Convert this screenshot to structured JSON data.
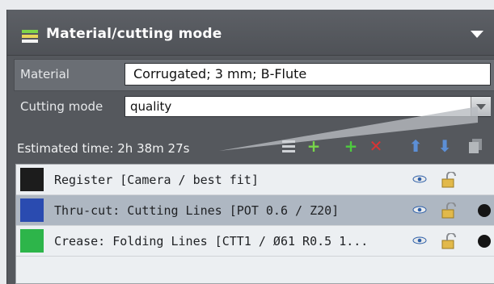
{
  "header": {
    "title": "Material/cutting mode",
    "icon": "layers-icon",
    "collapse_icon": "chevron-down-icon"
  },
  "material": {
    "label": "Material",
    "value": "Corrugated; 3 mm; B-Flute"
  },
  "cutting_mode": {
    "label": "Cutting mode",
    "value": "quality"
  },
  "estimated_time": "Estimated time: 2h 38m 27s",
  "toolbar": [
    "list-view-icon",
    "add-icon",
    "add-sub-icon",
    "delete-icon",
    "move-up-icon",
    "move-down-icon",
    "copy-icon"
  ],
  "layers": [
    {
      "label": "Register [Camera / best fit]",
      "color": "#1c1c1c",
      "selected": false,
      "has_dot": false
    },
    {
      "label": "Thru-cut: Cutting Lines [POT 0.6 / Z20]",
      "color": "#2a4bb0",
      "selected": true,
      "has_dot": true
    },
    {
      "label": "Crease: Folding Lines [CTT1 / Ø61 R0.5 1...",
      "color": "#2db54a",
      "selected": false,
      "has_dot": true
    }
  ]
}
